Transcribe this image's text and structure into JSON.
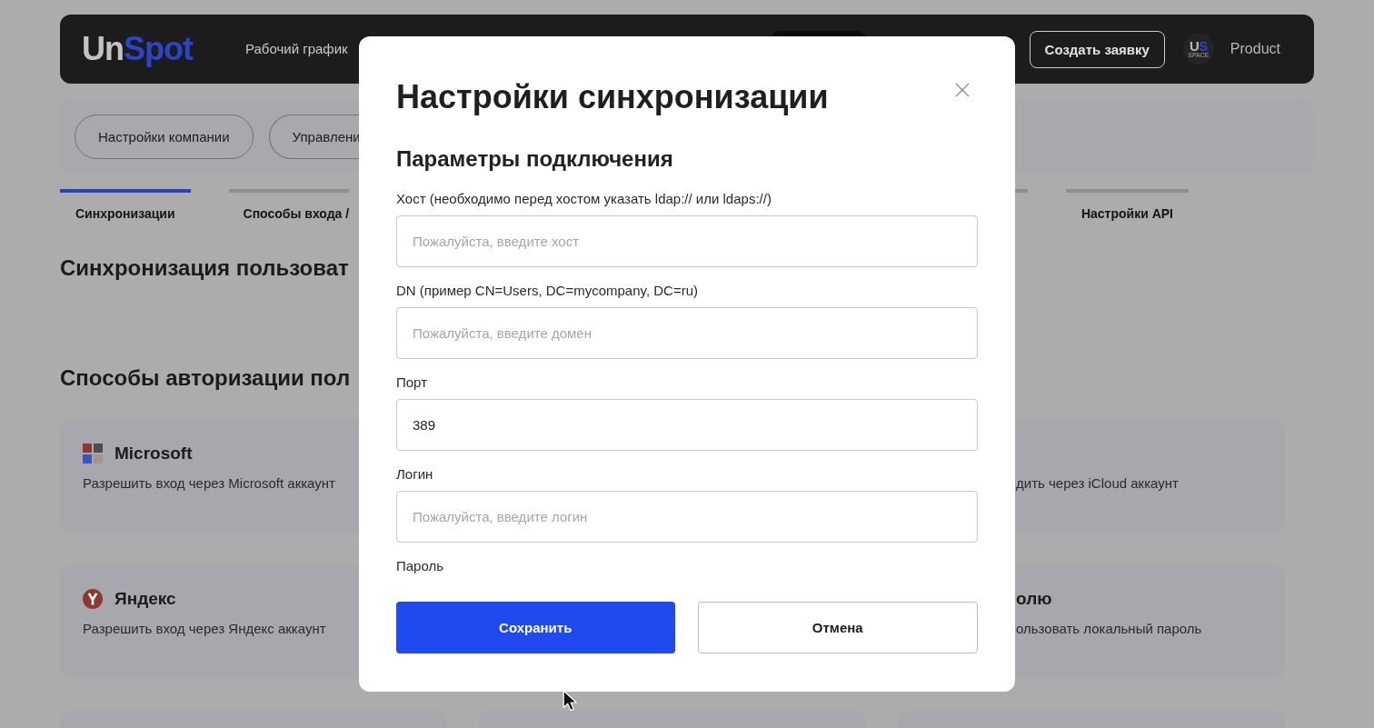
{
  "header": {
    "logo": {
      "prefix": "Un",
      "accent": "Spot"
    },
    "nav": [
      {
        "label": "Рабочий график"
      }
    ],
    "create_button": "Создать заявку",
    "org_logo": {
      "prefix": "U",
      "accent": "S",
      "caption": "SPACE"
    },
    "org_name": "Product"
  },
  "settings_nav": [
    {
      "label": "Настройки компании"
    },
    {
      "label": "Управлени"
    }
  ],
  "tabs": [
    {
      "label": "Синхронизации",
      "selected": true
    },
    {
      "label": "Способы входа /",
      "selected": false
    },
    {
      "label": "Настройки API",
      "selected": false
    }
  ],
  "sync_section": {
    "title": "Синхронизация пользоват"
  },
  "auth_section": {
    "title": "Способы авторизации пол",
    "cards": {
      "left": [
        {
          "kind": "microsoft",
          "title": "Microsoft",
          "description": "Разрешить вход через Microsoft аккаунт"
        },
        {
          "kind": "yandex",
          "title": "Яндекс",
          "description": "Разрешить вход через Яндекс аккаунт"
        }
      ],
      "right": [
        {
          "description": "дить через iCloud аккаунт"
        },
        {
          "title": "олю",
          "description": "ользовать локальный пароль"
        }
      ]
    }
  },
  "dialog": {
    "title": "Настройки синхронизации",
    "section": "Параметры подключения",
    "fields": [
      {
        "label": "Хост (необходимо перед хостом указать ldap:// или ldaps://)",
        "placeholder": "Пожалуйста, введите хост"
      },
      {
        "label": "DN (пример CN=Users, DC=mycompany, DC=ru)",
        "placeholder": "Пожалуйста, введите домен"
      },
      {
        "label": "Порт",
        "value": "389"
      },
      {
        "label": "Логин",
        "placeholder": "Пожалуйста, введите логин"
      },
      {
        "label": "Пароль"
      }
    ],
    "buttons": [
      {
        "label": "Сохранить",
        "kind": "primary"
      },
      {
        "label": "Отмена",
        "kind": "secondary"
      }
    ]
  }
}
